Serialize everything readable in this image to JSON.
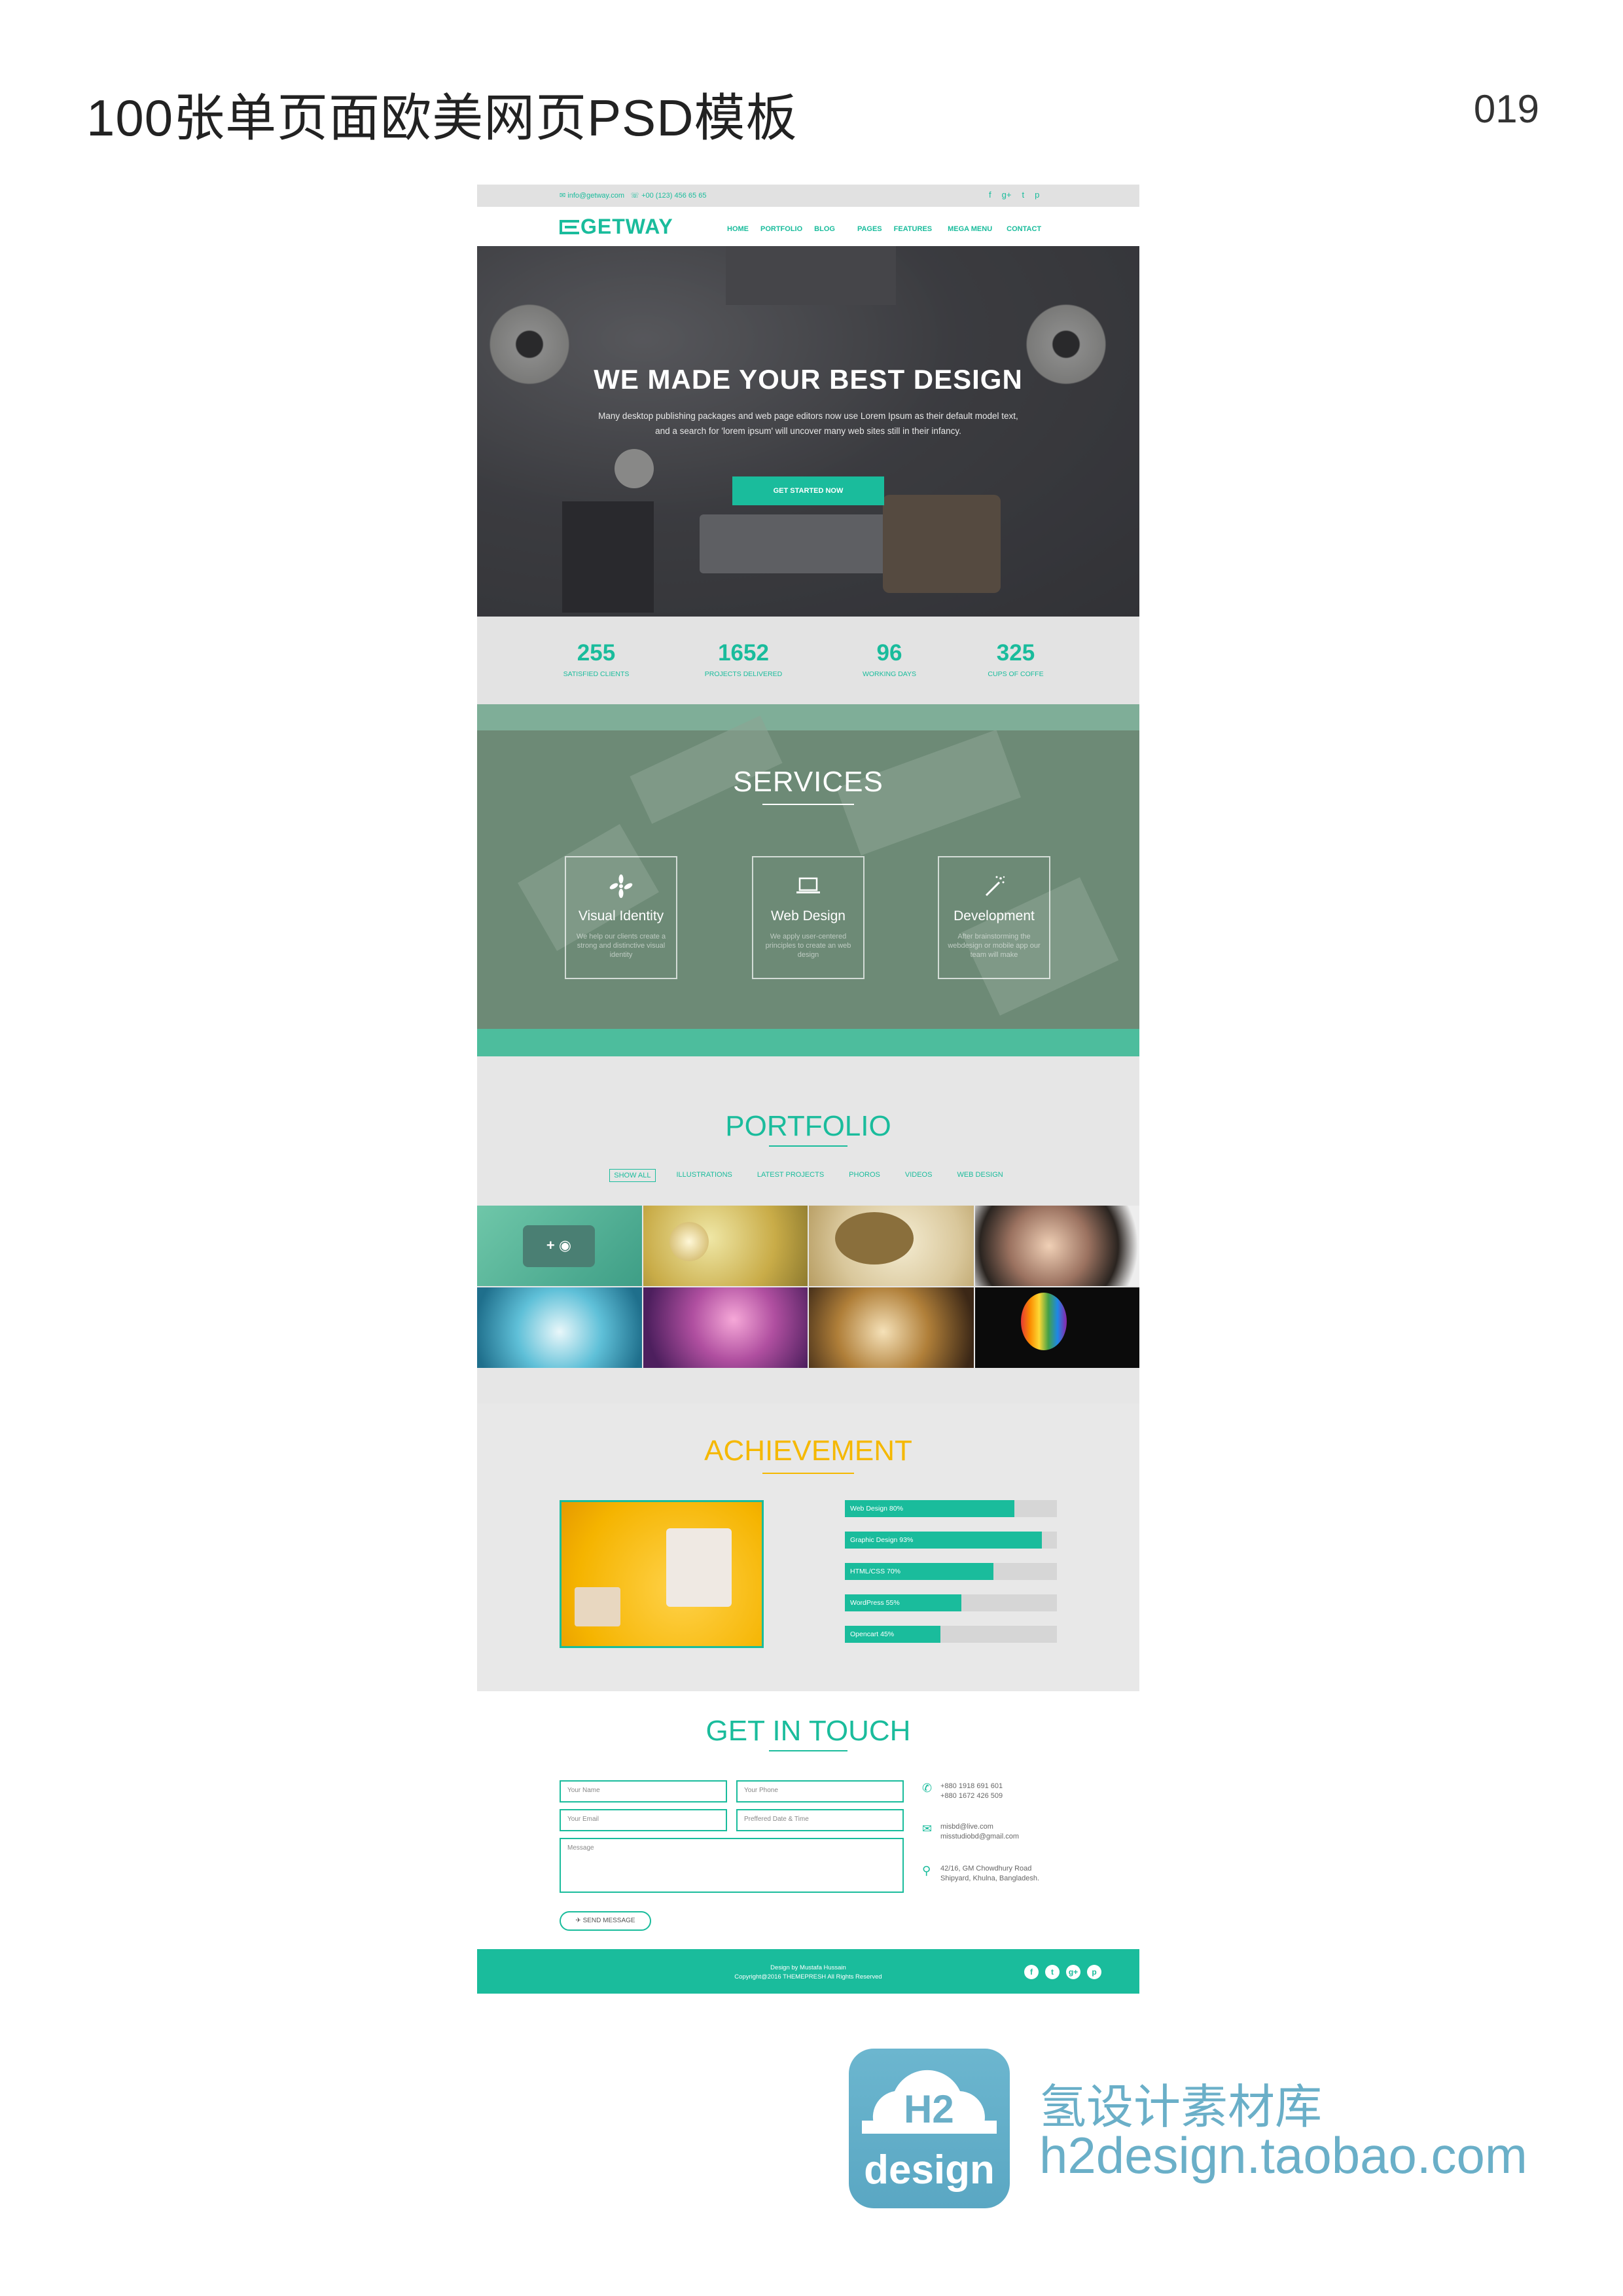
{
  "sheet": {
    "title": "100张单页面欧美网页PSD模板",
    "number": "019"
  },
  "site": {
    "topbar": {
      "email": "info@getway.com",
      "phone": "+00 (123) 456 65 65",
      "social_icons": [
        "facebook-icon",
        "google-plus-icon",
        "twitter-icon",
        "pinterest-icon"
      ]
    },
    "logo": "GETWAY",
    "nav": [
      "HOME",
      "PORTFOLIO",
      "BLOG",
      "PAGES",
      "FEATURES",
      "MEGA MENU",
      "CONTACT"
    ],
    "hero": {
      "title": "WE MADE YOUR BEST DESIGN",
      "subtitle_line1": "Many desktop publishing packages and web page editors now use Lorem Ipsum as their default model text,",
      "subtitle_line2": "and a search for 'lorem ipsum' will uncover many web sites still in their infancy.",
      "button": "GET STARTED NOW"
    },
    "stats": [
      {
        "value": "255",
        "label": "SATISFIED CLIENTS"
      },
      {
        "value": "1652",
        "label": "PROJECTS DELIVERED"
      },
      {
        "value": "96",
        "label": "WORKING DAYS"
      },
      {
        "value": "325",
        "label": "CUPS OF COFFE"
      }
    ],
    "services": {
      "title": "SERVICES",
      "items": [
        {
          "icon": "pinwheel-icon",
          "name": "Visual Identity",
          "desc": "We help our clients create a strong and distinctive visual identity"
        },
        {
          "icon": "laptop-icon",
          "name": "Web Design",
          "desc": "We apply user-centered principles to create an web design"
        },
        {
          "icon": "magic-wand-icon",
          "name": "Development",
          "desc": "After brainstorming the webdesign or mobile app our team will make"
        }
      ]
    },
    "portfolio": {
      "title": "PORTFOLIO",
      "filters": [
        "SHOW ALL",
        "ILLUSTRATIONS",
        "LATEST PROJECTS",
        "PHOROS",
        "VIDEOS",
        "WEB DESIGN"
      ],
      "tiles": [
        "camera",
        "dandelion",
        "tree-illustration",
        "portrait",
        "succulent",
        "flowers",
        "vintage-camera",
        "rainbow-balloon"
      ]
    },
    "achievement": {
      "title": "ACHIEVEMENT",
      "skills": [
        {
          "label": "Web Design  80%",
          "value": 80
        },
        {
          "label": "Graphic Design 93%",
          "value": 93
        },
        {
          "label": "HTML/CSS  70%",
          "value": 70
        },
        {
          "label": "WordPress 55%",
          "value": 55
        },
        {
          "label": "Opencart 45%",
          "value": 45
        }
      ]
    },
    "contact": {
      "title": "GET IN TOUCH",
      "fields": {
        "name": "Your Name",
        "phone": "Your Phone",
        "email": "Your Email",
        "date": "Preffered Date & Time",
        "message": "Message"
      },
      "send": "SEND MESSAGE",
      "phones": [
        "+880 1918 691 601",
        "+880 1672 426 509"
      ],
      "emails": [
        "misbd@live.com",
        "misstudiobd@gmail.com"
      ],
      "address": [
        "42/16, GM Chowdhury Road",
        "Shipyard, Khulna, Bangladesh."
      ]
    },
    "footer": {
      "line1": "Design by Mustafa Hussain",
      "line2": "Copyright@2016 THEMEPRESH All Rights Reserved",
      "social": [
        "f",
        "t",
        "g+",
        "p"
      ]
    }
  },
  "brand": {
    "logo_top": "H2",
    "logo_bottom": "design",
    "cn": "氢设计素材库",
    "url": "h2design.taobao.com"
  },
  "colors": {
    "accent": "#1abc9c",
    "achievement": "#f5b800",
    "brand": "#6aafc8"
  }
}
